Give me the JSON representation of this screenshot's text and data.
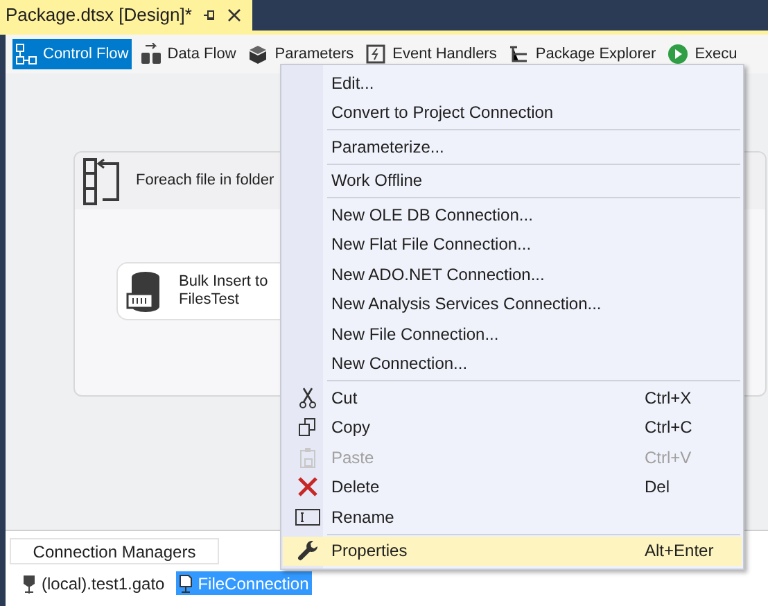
{
  "document_tab": {
    "title": "Package.dtsx [Design]*"
  },
  "designer_tabs": [
    {
      "label": "Control Flow",
      "selected": true
    },
    {
      "label": "Data Flow",
      "selected": false
    },
    {
      "label": "Parameters",
      "selected": false
    },
    {
      "label": "Event Handlers",
      "selected": false
    },
    {
      "label": "Package Explorer",
      "selected": false
    },
    {
      "label": "Execu",
      "selected": false
    }
  ],
  "canvas": {
    "container": {
      "title": "Foreach file in folder"
    },
    "task": {
      "title": "Bulk Insert to FilesTest"
    }
  },
  "context_menu": {
    "groups": [
      [
        {
          "label": "Edit...",
          "disabled": false,
          "selected": false
        },
        {
          "label": "Convert to Project Connection",
          "disabled": false,
          "selected": false
        }
      ],
      [
        {
          "label": "Parameterize...",
          "disabled": false,
          "selected": false
        }
      ],
      [
        {
          "label": "Work Offline",
          "disabled": false,
          "selected": false
        }
      ],
      [
        {
          "label": "New OLE DB Connection...",
          "disabled": false,
          "selected": false
        },
        {
          "label": "New Flat File Connection...",
          "disabled": false,
          "selected": false
        },
        {
          "label": "New ADO.NET Connection...",
          "disabled": false,
          "selected": false
        },
        {
          "label": "New Analysis Services Connection...",
          "disabled": false,
          "selected": false
        },
        {
          "label": "New File Connection...",
          "disabled": false,
          "selected": false
        },
        {
          "label": "New Connection...",
          "disabled": false,
          "selected": false
        }
      ],
      [
        {
          "label": "Cut",
          "shortcut": "Ctrl+X",
          "disabled": false,
          "selected": false
        },
        {
          "label": "Copy",
          "shortcut": "Ctrl+C",
          "disabled": false,
          "selected": false
        },
        {
          "label": "Paste",
          "shortcut": "Ctrl+V",
          "disabled": true,
          "selected": false
        },
        {
          "label": "Delete",
          "shortcut": "Del",
          "disabled": false,
          "selected": false
        },
        {
          "label": "Rename",
          "disabled": false,
          "selected": false
        }
      ],
      [
        {
          "label": "Properties",
          "shortcut": "Alt+Enter",
          "disabled": false,
          "selected": true
        }
      ]
    ]
  },
  "connection_managers": {
    "title": "Connection Managers",
    "items": [
      {
        "label": "(local).test1.gato",
        "selected": false
      },
      {
        "label": "FileConnection",
        "selected": true
      }
    ]
  }
}
